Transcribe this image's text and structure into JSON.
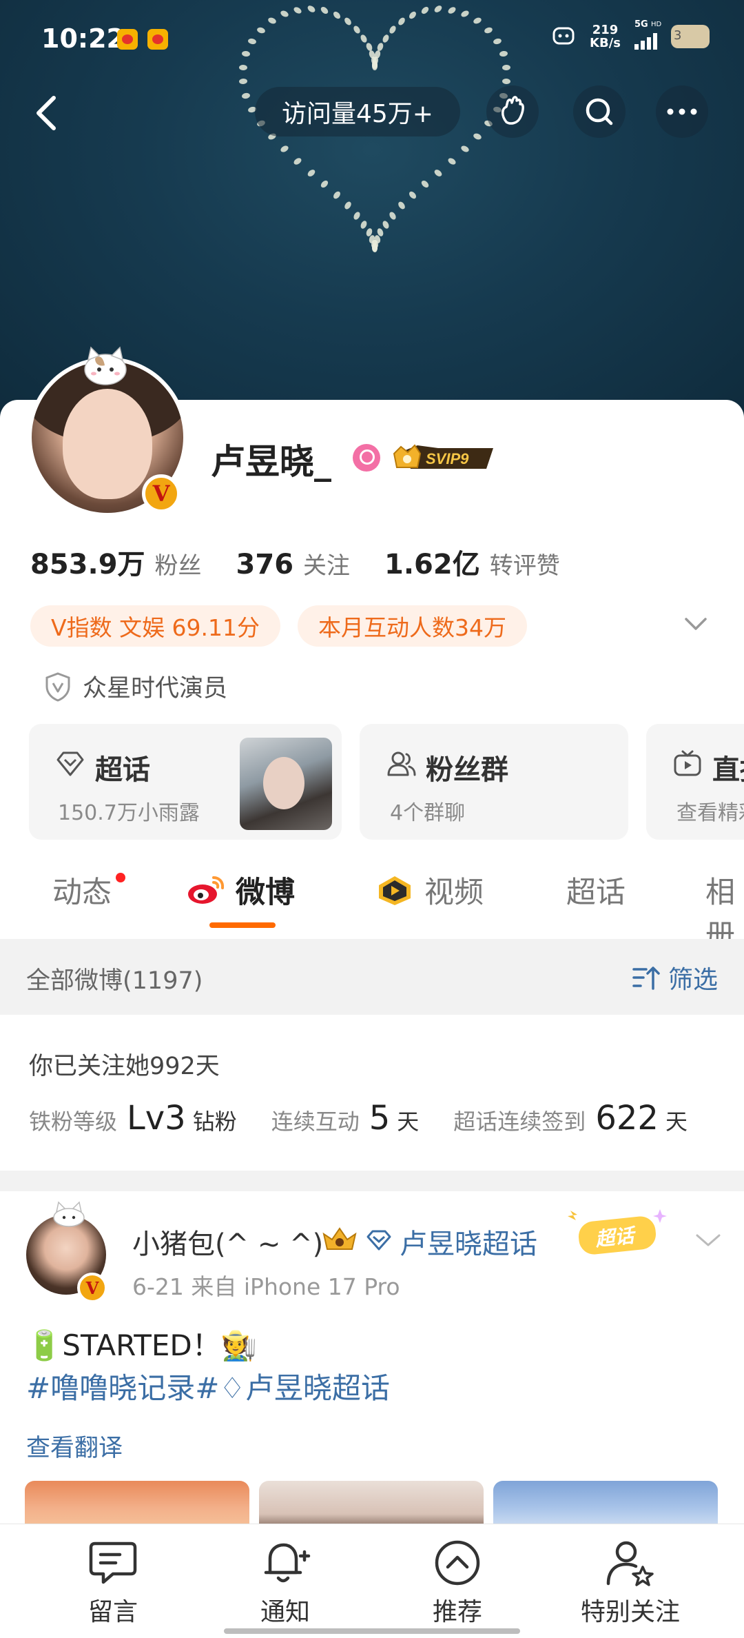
{
  "status_bar": {
    "time": "10:22",
    "net_speed_value": "219",
    "net_speed_unit": "KB/s",
    "network": "5G",
    "network_hd": "HD",
    "battery": "3"
  },
  "nav": {
    "visit_label": "访问量45万+"
  },
  "profile": {
    "username": "卢昱晓_",
    "vip_badge": "SVIP9",
    "verified_mark": "V",
    "stats": [
      {
        "value": "853.9万",
        "label": "粉丝"
      },
      {
        "value": "376",
        "label": "关注"
      },
      {
        "value": "1.62亿",
        "label": "转评赞"
      }
    ],
    "chips": [
      "V指数 文娱 69.11分",
      "本月互动人数34万"
    ],
    "certification": "众星时代演员"
  },
  "tiles": [
    {
      "title": "超话",
      "subtitle": "150.7万小雨露"
    },
    {
      "title": "粉丝群",
      "subtitle": "4个群聊"
    },
    {
      "title": "直播",
      "subtitle": "查看精彩"
    }
  ],
  "tabs": [
    {
      "label": "动态"
    },
    {
      "label": "微博"
    },
    {
      "label": "视频"
    },
    {
      "label": "超话"
    },
    {
      "label": "相册"
    }
  ],
  "feed_header": {
    "count_label": "全部微博(1197)",
    "filter_label": "筛选"
  },
  "follow_info": {
    "days_text": "你已关注她992天",
    "fan_level_label": "铁粉等级",
    "fan_level_value": "Lv3",
    "fan_level_unit": "钻粉",
    "interact_label": "连续互动",
    "interact_value": "5",
    "interact_unit": "天",
    "checkin_label": "超话连续签到",
    "checkin_value": "622",
    "checkin_unit": "天"
  },
  "post": {
    "author": "小猪包(^ ~ ^)",
    "topic": "卢昱晓超话",
    "sticker": "超话",
    "meta": "6-21  来自 iPhone 17 Pro",
    "text": "🔋STARTED！🧑‍🌾",
    "tags": "#噜噜晓记录#♢卢昱晓超话",
    "translate": "查看翻译"
  },
  "bottom_bar": [
    {
      "label": "留言",
      "icon": "message-icon"
    },
    {
      "label": "通知",
      "icon": "bell-plus-icon"
    },
    {
      "label": "推荐",
      "icon": "up-circle-icon"
    },
    {
      "label": "特别关注",
      "icon": "user-star-icon"
    }
  ],
  "colors": {
    "accent_orange": "#ff6a00",
    "link_blue": "#3b6ea5",
    "chip_bg": "#fff1e8",
    "chip_text": "#ee6a1b"
  }
}
